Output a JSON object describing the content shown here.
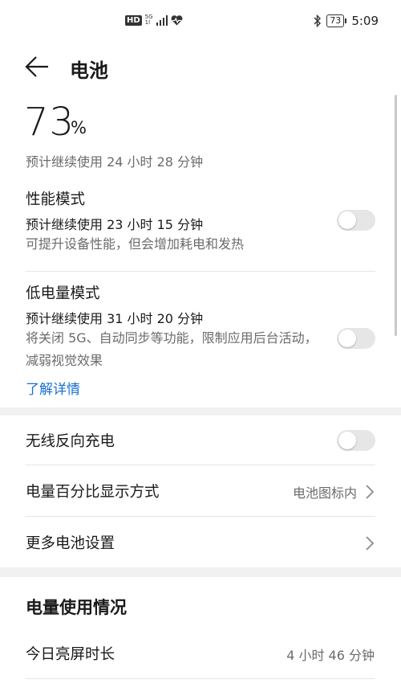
{
  "status_bar": {
    "hd": "HD",
    "net_top": "5G",
    "net_bottom": "1l",
    "battery_level": "73",
    "time": "5:09",
    "icons": [
      "hd-icon",
      "signal-icon",
      "health-icon",
      "bluetooth-icon",
      "battery-icon"
    ]
  },
  "header": {
    "title": "电池",
    "back_icon": "arrow-left-icon"
  },
  "battery": {
    "percent": "73",
    "percent_sign": "%",
    "estimate": "预计继续使用 24 小时 28 分钟"
  },
  "performance_mode": {
    "title": "性能模式",
    "estimate": "预计继续使用 23 小时 15 分钟",
    "description": "可提升设备性能，但会增加耗电和发热",
    "enabled": false
  },
  "low_power_mode": {
    "title": "低电量模式",
    "estimate": "预计继续使用 31 小时 20 分钟",
    "description": "将关闭 5G、自动同步等功能，限制应用后台活动，减弱视觉效果",
    "enabled": false,
    "learn_more": "了解详情"
  },
  "settings": {
    "wireless_reverse": {
      "label": "无线反向充电",
      "enabled": false
    },
    "percent_display": {
      "label": "电量百分比显示方式",
      "value": "电池图标内"
    },
    "more_settings": {
      "label": "更多电池设置"
    }
  },
  "usage": {
    "title": "电量使用情况",
    "screen_on_label": "今日亮屏时长",
    "screen_on_value": "4 小时 46 分钟"
  },
  "colors": {
    "link": "#1a6fd1",
    "toggle_off": "#e6e6e6",
    "section_gap": "#f1f1f1"
  }
}
